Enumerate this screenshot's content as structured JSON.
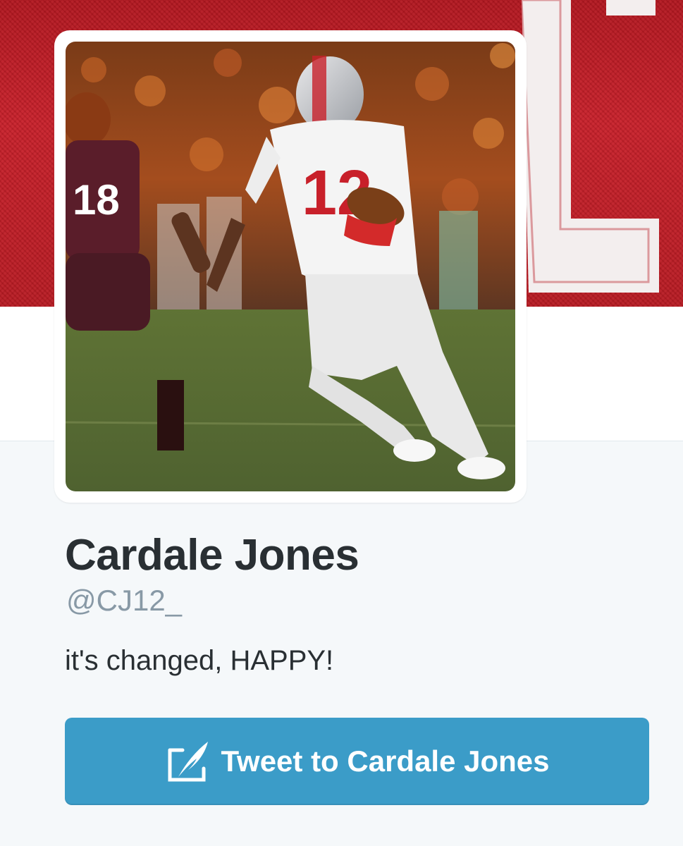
{
  "profile": {
    "name": "Cardale Jones",
    "handle": "@CJ12_",
    "bio": "it's changed, HAPPY!"
  },
  "actions": {
    "tweet_to_label": "Tweet to Cardale Jones",
    "tweet_icon": "compose-tweet-icon"
  },
  "avatar": {
    "description_icon": "football-player-photo",
    "jersey_number_primary": "12",
    "jersey_number_secondary": "18"
  },
  "colors": {
    "banner": "#c8202a",
    "button": "#3b9cc8",
    "name_text": "#292f33",
    "handle_text": "#8899a6",
    "page_background": "#f5f8fa"
  }
}
